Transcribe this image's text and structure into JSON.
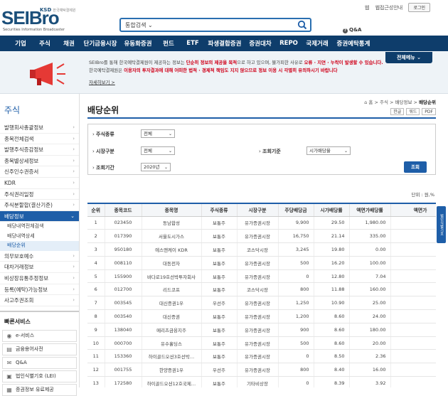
{
  "header": {
    "logo_text": "SEIBro",
    "logo_sub": "Securities Information Broadcaster",
    "ksd": "KSD",
    "ksd_sub": "한국예탁결제원",
    "search_scope": "통합검색",
    "top_links": [
      "웹",
      "웹접근성안내"
    ],
    "login_label": "로그인",
    "qa_label": "Q&A"
  },
  "gnb": [
    "기업",
    "주식",
    "채권",
    "단기금융시장",
    "유동화증권",
    "펀드",
    "ETF",
    "파생결합증권",
    "증권대차",
    "REPO",
    "국제거래",
    "증권예탁통계"
  ],
  "banner": {
    "all_menu": "전체메뉴",
    "line1_a": "SEIBro를 통해 한국예탁결제원이 제공하는 정보는 ",
    "line1_red": "단순히 정보의 제공을 목적",
    "line1_b": "으로 하고 있으며, 불가피한 사유로 ",
    "line1_red2": "오류 · 지연 · 누락이 발생할 수 있습니다.",
    "line2_a": "한국예탁결제원은 ",
    "line2_red": "이용자의 투자결과에 대해 어떠한 법적 · 경제적 책임도 지지 않으므로 정보 이용 시 각별히 유의하시기 바랍니다",
    "more": "자세히보기 >"
  },
  "lnb": {
    "title": "주식",
    "items": [
      "발행회사총괄정보",
      "종목전체검색",
      "발행주식증감정보",
      "종목별상세정보",
      "신주인수권증서",
      "KDR",
      "주식권리일정",
      "주식분할합(결산기준)",
      "배당정보"
    ],
    "sub_items": [
      "배당내역전체검색",
      "배당내역상세",
      "배당순위"
    ],
    "items2": [
      "의무보호예수",
      "대차거래정보",
      "비상장유통추정정보",
      "등록(예탁)가능정보",
      "사고주권조회"
    ],
    "quick_title": "빠른서비스",
    "quick_items": [
      "e-서비스",
      "금융용어사전",
      "Q&A",
      "법인식별기호 (LEI)",
      "증권정보 유료제공"
    ]
  },
  "content": {
    "page_title": "배당순위",
    "breadcrumb": [
      "홈",
      "주식",
      "배당정보"
    ],
    "breadcrumb_current": "배당순위",
    "tools": [
      "한글",
      "워드",
      "PDF"
    ],
    "filter": {
      "stock_type_label": "주식종류",
      "stock_type_value": "전체",
      "market_label": "시장구분",
      "market_value": "전체",
      "criteria_label": "조회기준",
      "criteria_value": "시가배당율",
      "period_label": "조회기간",
      "period_value": "2020년",
      "query_button": "조회"
    },
    "unit": "단위 : 원,%",
    "side_float": "법인식별기호"
  },
  "table": {
    "headers": [
      "순위",
      "종목코드",
      "종목명",
      "주식종류",
      "시장구분",
      "주당배당금",
      "시가배당률",
      "액면가배당률",
      "액면가"
    ],
    "rows": [
      [
        "1",
        "023450",
        "동남합성",
        "보통주",
        "유가증권시장",
        "9,900",
        "29.50",
        "1,980.00",
        "5"
      ],
      [
        "2",
        "017390",
        "서울도시가스",
        "보통주",
        "유가증권시장",
        "16,750",
        "21.14",
        "335.00",
        "5,"
      ],
      [
        "3",
        "950180",
        "에스앤케이 KDR",
        "보통주",
        "코스닥시장",
        "3,245",
        "19.80",
        "0.00",
        ""
      ],
      [
        "4",
        "008110",
        "대동전자",
        "보통주",
        "유가증권시장",
        "500",
        "16.20",
        "100.00",
        ""
      ],
      [
        "5",
        "155900",
        "바다로19호선박투자회사",
        "보통주",
        "유가증권시장",
        "0",
        "12.80",
        "7.04",
        "5,"
      ],
      [
        "6",
        "012700",
        "리드코프",
        "보통주",
        "코스닥시장",
        "800",
        "11.88",
        "160.00",
        ""
      ],
      [
        "7",
        "003545",
        "대신증권1우",
        "우선주",
        "유가증권시장",
        "1,250",
        "10.90",
        "25.00",
        "5,"
      ],
      [
        "8",
        "003540",
        "대신증권",
        "보통주",
        "유가증권시장",
        "1,200",
        "8.60",
        "24.00",
        "5,"
      ],
      [
        "9",
        "138040",
        "메리츠금융지주",
        "보통주",
        "유가증권시장",
        "900",
        "8.60",
        "180.00",
        ""
      ],
      [
        "10",
        "000700",
        "유수홀딩스",
        "보통주",
        "유가증권시장",
        "500",
        "8.60",
        "20.00",
        "2"
      ],
      [
        "11",
        "153360",
        "하이골드오션3호선박…",
        "보통주",
        "유가증권시장",
        "0",
        "8.50",
        "2.36",
        "5,"
      ],
      [
        "12",
        "001755",
        "한양증권1우",
        "우선주",
        "유가증권시장",
        "800",
        "8.40",
        "16.00",
        "5,"
      ],
      [
        "13",
        "172580",
        "하이골드오션12호국제…",
        "보통주",
        "기타비상장",
        "0",
        "8.39",
        "3.92",
        "5,"
      ]
    ]
  },
  "colors": {
    "navy": "#0e3d6b",
    "accent": "#1e5ea8",
    "red": "#d0021b"
  }
}
